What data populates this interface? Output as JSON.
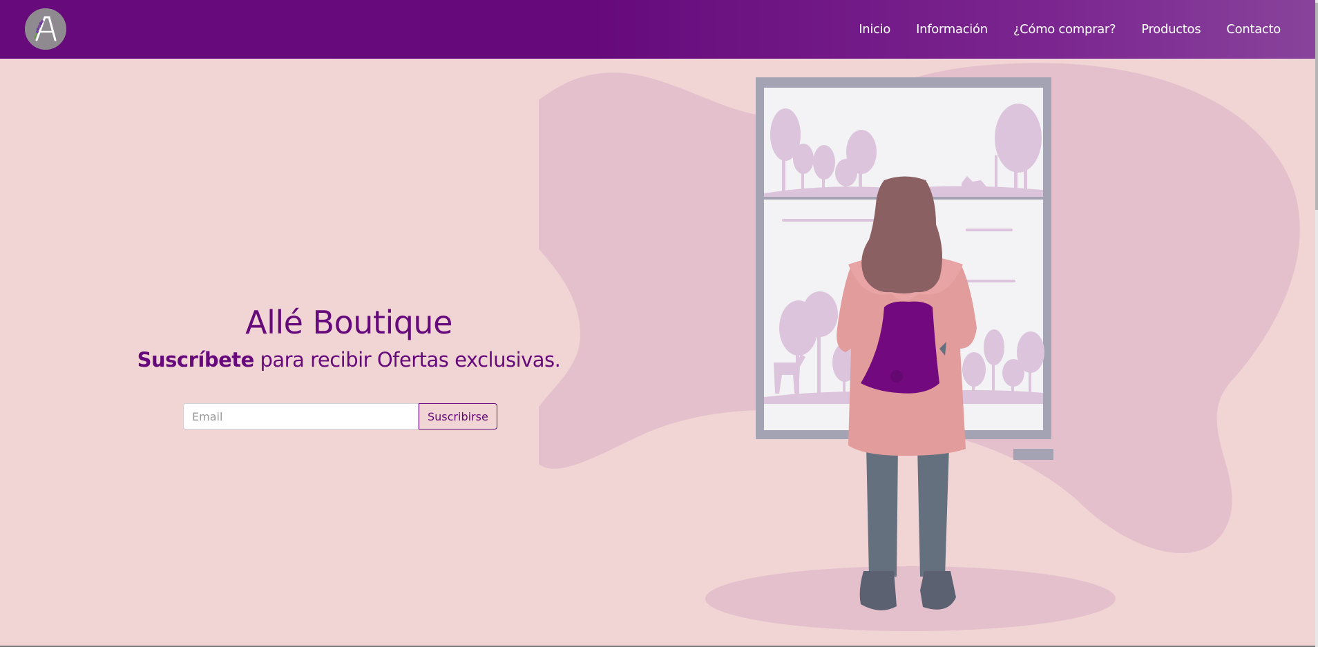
{
  "brand": {
    "logo_icon": "lavender-a-monogram-icon",
    "logo_letter": "A"
  },
  "nav": {
    "items": [
      {
        "label": "Inicio"
      },
      {
        "label": "Información"
      },
      {
        "label": "¿Cómo comprar?"
      },
      {
        "label": "Productos"
      },
      {
        "label": "Contacto"
      }
    ]
  },
  "hero": {
    "title": "Allé Boutique",
    "subtitle_bold": "Suscríbete",
    "subtitle_rest": " para recibir Ofertas exclusivas.",
    "email_placeholder": "Email",
    "subscribe_label": "Suscribirse",
    "illustration": "girl-looking-through-window-illustration"
  },
  "colors": {
    "primary": "#660a7b",
    "background": "#f1d4d4",
    "blob": "#e4c0cd",
    "coat": "#e29c9c",
    "backpack": "#72097f"
  }
}
